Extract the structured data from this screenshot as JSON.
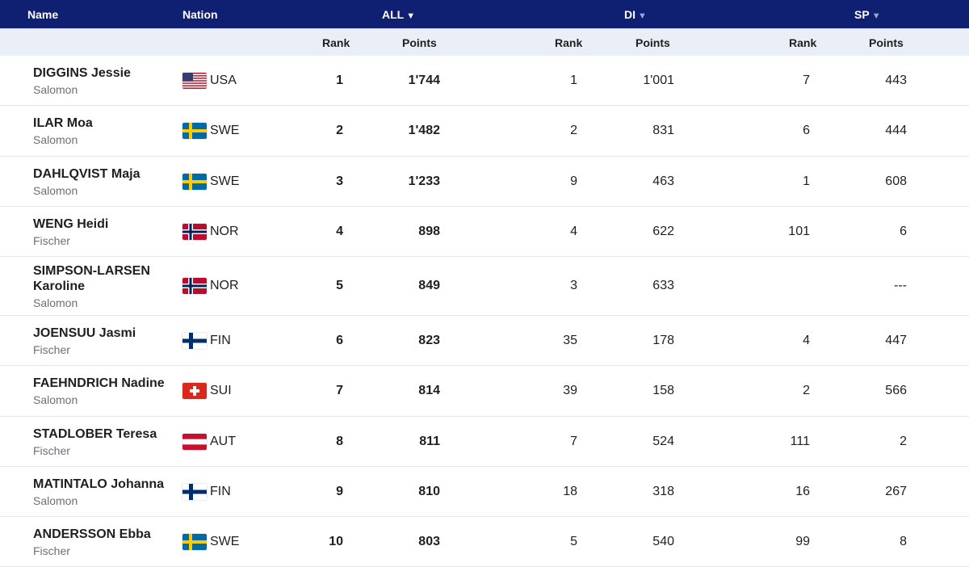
{
  "header": {
    "name": "Name",
    "nation": "Nation",
    "groups": [
      {
        "label": "ALL",
        "caret": "▼",
        "dim": false
      },
      {
        "label": "DI",
        "caret": "▼",
        "dim": true
      },
      {
        "label": "SP",
        "caret": "▼",
        "dim": true
      }
    ],
    "sub": {
      "rank": "Rank",
      "points": "Points"
    }
  },
  "rows": [
    {
      "name": "DIGGINS Jessie",
      "brand": "Salomon",
      "flag": "usa",
      "nation": "USA",
      "all_rank": "1",
      "all_points": "1'744",
      "di_rank": "1",
      "di_points": "1'001",
      "sp_rank": "7",
      "sp_points": "443"
    },
    {
      "name": "ILAR Moa",
      "brand": "Salomon",
      "flag": "swe",
      "nation": "SWE",
      "all_rank": "2",
      "all_points": "1'482",
      "di_rank": "2",
      "di_points": "831",
      "sp_rank": "6",
      "sp_points": "444"
    },
    {
      "name": "DAHLQVIST Maja",
      "brand": "Salomon",
      "flag": "swe",
      "nation": "SWE",
      "all_rank": "3",
      "all_points": "1'233",
      "di_rank": "9",
      "di_points": "463",
      "sp_rank": "1",
      "sp_points": "608"
    },
    {
      "name": "WENG Heidi",
      "brand": "Fischer",
      "flag": "nor",
      "nation": "NOR",
      "all_rank": "4",
      "all_points": "898",
      "di_rank": "4",
      "di_points": "622",
      "sp_rank": "101",
      "sp_points": "6"
    },
    {
      "name": "SIMPSON-LARSEN Karoline",
      "brand": "Salomon",
      "flag": "nor",
      "nation": "NOR",
      "all_rank": "5",
      "all_points": "849",
      "di_rank": "3",
      "di_points": "633",
      "sp_rank": "",
      "sp_points": "---"
    },
    {
      "name": "JOENSUU Jasmi",
      "brand": "Fischer",
      "flag": "fin",
      "nation": "FIN",
      "all_rank": "6",
      "all_points": "823",
      "di_rank": "35",
      "di_points": "178",
      "sp_rank": "4",
      "sp_points": "447"
    },
    {
      "name": "FAEHNDRICH Nadine",
      "brand": "Salomon",
      "flag": "sui",
      "nation": "SUI",
      "all_rank": "7",
      "all_points": "814",
      "di_rank": "39",
      "di_points": "158",
      "sp_rank": "2",
      "sp_points": "566"
    },
    {
      "name": "STADLOBER Teresa",
      "brand": "Fischer",
      "flag": "aut",
      "nation": "AUT",
      "all_rank": "8",
      "all_points": "811",
      "di_rank": "7",
      "di_points": "524",
      "sp_rank": "111",
      "sp_points": "2"
    },
    {
      "name": "MATINTALO Johanna",
      "brand": "Salomon",
      "flag": "fin",
      "nation": "FIN",
      "all_rank": "9",
      "all_points": "810",
      "di_rank": "18",
      "di_points": "318",
      "sp_rank": "16",
      "sp_points": "267"
    },
    {
      "name": "ANDERSSON Ebba",
      "brand": "Fischer",
      "flag": "swe",
      "nation": "SWE",
      "all_rank": "10",
      "all_points": "803",
      "di_rank": "5",
      "di_points": "540",
      "sp_rank": "99",
      "sp_points": "8"
    }
  ],
  "colors": {
    "header_bg": "#0f2073",
    "subheader_bg": "#e9eef7",
    "text": "#1f1f1f",
    "muted": "#6b6f76"
  }
}
